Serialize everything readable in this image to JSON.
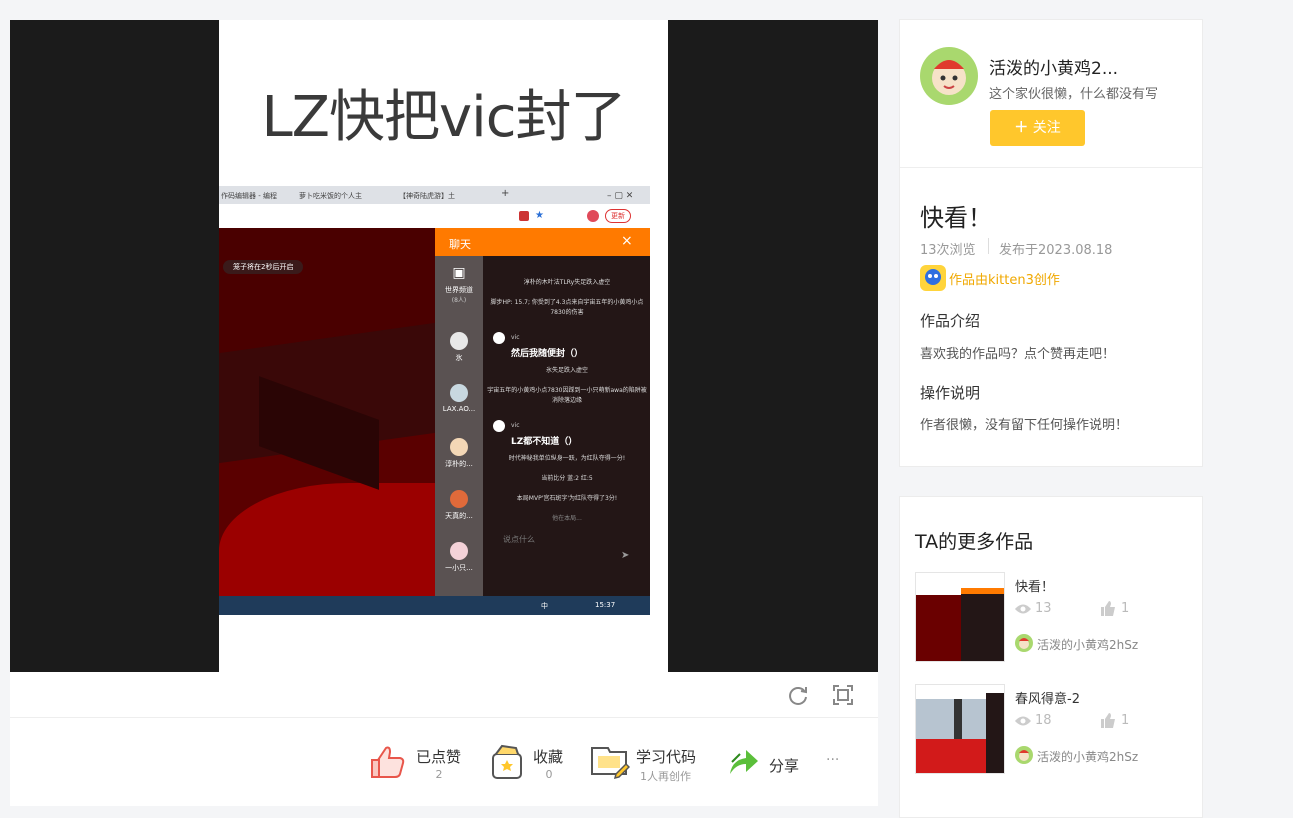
{
  "banner_text": "LZ快把vic封了",
  "screenshot": {
    "tabs": [
      "作码编辑器 - 编程",
      "萝卜吃米饭的个人主",
      "【神奇陆虎游】土"
    ],
    "update_button": "更新",
    "game_notice": "笼子将在2秒后开启",
    "chat": {
      "title": "聊天",
      "close": "×",
      "world_channel": "世界频道",
      "world_count": "(8人)",
      "players": [
        "氷",
        "LAX.AO...",
        "淳朴的...",
        "天真的...",
        "一小只..."
      ],
      "messages_top": [
        "淳朴的木叶法TLRy失足跌入虚空",
        "脚步HP: 15.7; 你受到了4.3点来自宇宙五年的小黄鸡小点7830的伤害"
      ],
      "vic_name": "vic",
      "vic_msg1": "然后我随便封（）",
      "messages_mid": [
        "氷失足跌入虚空",
        "宇宙五年的小黄鸡小点7830因踩到一小只萌新awa的陷阱被消除落边缘"
      ],
      "vic_msg2": "LZ都不知道（）",
      "messages_bottom": [
        "时代神秘我单位纵身一跃，为红队夺得一分!",
        "当前比分 蓝:2 红:5",
        "本局MVP'宫石斑字'为红队夺得了3分!",
        "他在本局..."
      ],
      "input_placeholder": "说点什么",
      "send": "➤"
    },
    "taskbar_time": "15:37",
    "taskbar_lang": "中"
  },
  "actions": {
    "like_label": "已点赞",
    "like_count": "2",
    "fav_label": "收藏",
    "fav_count": "0",
    "code_label": "学习代码",
    "code_sub": "1人再创作",
    "share_label": "分享",
    "more": "···"
  },
  "author": {
    "name": "活泼的小黄鸡2...",
    "bio": "这个家伙很懒，什么都没有写",
    "follow_label": "关注"
  },
  "work": {
    "title": "快看！",
    "views": "13次浏览",
    "published": "发布于2023.08.18",
    "created_with": "作品由kitten3创作",
    "intro_heading": "作品介绍",
    "intro_text": "喜欢我的作品吗？点个赞再走吧！",
    "ops_heading": "操作说明",
    "ops_text": "作者很懒，没有留下任何操作说明！"
  },
  "more_works": {
    "heading": "TA的更多作品",
    "items": [
      {
        "title": "快看！",
        "views": "13",
        "likes": "1",
        "author": "活泼的小黄鸡2hSz"
      },
      {
        "title": "春风得意-2",
        "views": "18",
        "likes": "1",
        "author": "活泼的小黄鸡2hSz"
      }
    ]
  },
  "colors": {
    "accent": "#ffc72c",
    "chat_orange": "#ff7a00",
    "kitten_link": "#f0a800"
  }
}
